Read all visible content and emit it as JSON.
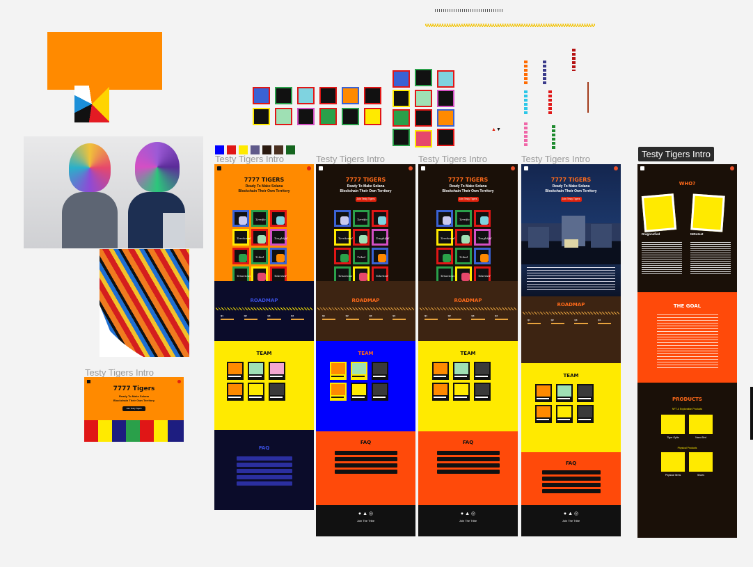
{
  "labels": {
    "intro_a": "Testy Tigers Intro",
    "intro_b": "Testy Tigers Intro",
    "intro_c": "Testy Tigers Intro",
    "intro_d": "Testy Tigers Intro",
    "intro_e": "Testy Tigers Intro",
    "intro_f": "Testy Tigers Intro"
  },
  "colors": {
    "orange": "#ff8a00",
    "navy": "#0b0c2a",
    "brown": "#3d2412",
    "yellow": "#ffea00",
    "blue": "#0000ff",
    "red": "#ff2a00",
    "black": "#1a1008",
    "swatches": [
      "#0000ff",
      "#e01616",
      "#ffea00",
      "#5f5a8a",
      "#3a2a1a",
      "#15651f"
    ]
  },
  "hero": {
    "title": "7777 TIGERS",
    "title_small": "7777 Tigers",
    "subtitle_1": "Ready To Make Solana",
    "subtitle_2": "Blockchain Their Own Territory",
    "cta": "Join Testy Tigers"
  },
  "tiles": [
    "",
    "Terrific",
    "",
    "Territorial",
    "",
    "Toughtful",
    "",
    "Tribal",
    "",
    "Tenacious",
    "",
    "Talented"
  ],
  "sections": {
    "roadmap": "ROADMAP",
    "team": "TEAM",
    "faq": "FAQ",
    "who": "WHO?",
    "goal": "THE GOAL",
    "products": "PRODUCTS",
    "join": "Join The Tribe"
  },
  "who": {
    "person1": "Dragonsfied",
    "person2": "NIDotest"
  },
  "products": {
    "p1": "Tiger Gyfts",
    "p2": "Nano Bird",
    "p3": "Physical Items",
    "p4": "Shoes",
    "head1": "NFT & Exploration Products",
    "head2": "Physical Products"
  }
}
